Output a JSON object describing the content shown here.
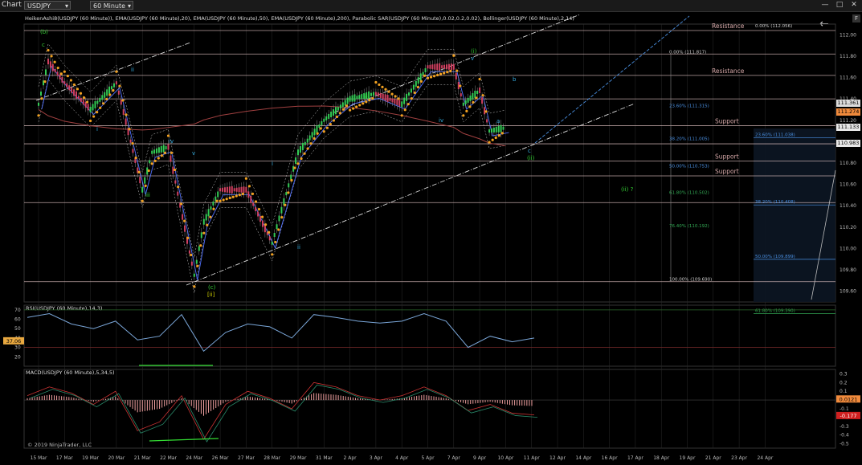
{
  "toolbar": {
    "chart_label": "Chart",
    "instrument": "USDJPY",
    "interval": "60 Minute",
    "back_icon": "arrow-left-icon",
    "f_button": "F"
  },
  "indicators_title": "HeikenAshi8(USDJPY (60 Minute)), EMA(USDJPY (60 Minute),20), EMA(USDJPY (60 Minute),50), EMA(USDJPY (60 Minute),200), Parabolic SAR(USDJPY (60 Minute),0.02,0.2,0.02), Bollinger(USDJPY (60 Minute),2,14)",
  "chart_data": [
    {
      "type": "line",
      "name": "price",
      "x_labels": [
        "15 Mar",
        "17 Mar",
        "19 Mar",
        "20 Mar",
        "21 Mar",
        "22 Mar",
        "24 Mar",
        "26 Mar",
        "27 Mar",
        "28 Mar",
        "29 Mar",
        "31 Mar",
        "2 Apr",
        "3 Apr",
        "4 Apr",
        "5 Apr",
        "7 Apr",
        "9 Apr",
        "10 Apr",
        "11 Apr",
        "12 Apr",
        "14 Apr",
        "16 Apr",
        "17 Apr",
        "18 Apr",
        "19 Apr",
        "21 Apr",
        "23 Apr",
        "24 Apr"
      ],
      "y_ticks": [
        "112.00",
        "111.80",
        "111.60",
        "111.40",
        "111.20",
        "111.00",
        "110.80",
        "110.60",
        "110.40",
        "110.20",
        "110.00",
        "109.80",
        "109.60"
      ],
      "ylim": [
        109.5,
        112.1
      ],
      "current_price": "111.133",
      "price_boxes": [
        {
          "label": "111.361",
          "value": 111.361,
          "bg": "#dcdcdc"
        },
        {
          "label": "111.274",
          "value": 111.274,
          "bg": "#f08a3c"
        },
        {
          "label": "111.133",
          "value": 111.133,
          "bg": "#e8e8e8"
        },
        {
          "label": "110.983",
          "value": 110.983,
          "bg": "#e8e8e8"
        }
      ],
      "levels": [
        {
          "label": "Resistance",
          "value": 112.04
        },
        {
          "label": "",
          "value": 111.82
        },
        {
          "label": "Resistance",
          "value": 111.62
        },
        {
          "label": "",
          "value": 111.4
        },
        {
          "label": "Support",
          "value": 111.15
        },
        {
          "label": "",
          "value": 110.98
        },
        {
          "label": "Support",
          "value": 110.82
        },
        {
          "label": "Support",
          "value": 110.68
        },
        {
          "label": "",
          "value": 110.43
        },
        {
          "label": "",
          "value": 109.69
        }
      ],
      "fib_retracement": [
        {
          "label": "0.00% (111.817)",
          "value": 111.817
        },
        {
          "label": "23.60% (111.315)",
          "value": 111.315
        },
        {
          "label": "38.20% (111.005)",
          "value": 111.005
        },
        {
          "label": "50.00% (110.753)",
          "value": 110.753
        },
        {
          "label": "61.80% (110.502)",
          "value": 110.502
        },
        {
          "label": "76.40% (110.192)",
          "value": 110.192
        },
        {
          "label": "100.00% (109.690)",
          "value": 109.69
        }
      ],
      "fib_extension": [
        {
          "label": "0.00% (112.056)",
          "value": 112.056
        },
        {
          "label": "23.60% (111.038)",
          "value": 111.038
        },
        {
          "label": "38.20% (110.408)",
          "value": 110.408
        },
        {
          "label": "50.00% (109.899)",
          "value": 109.899
        },
        {
          "label": "61.80% (109.390)",
          "value": 109.39
        }
      ],
      "wave_labels": [
        {
          "text": "(b)",
          "color": "#33cc33"
        },
        {
          "text": "c",
          "color": "#33cc33"
        },
        {
          "text": "ii",
          "color": "#33aadd"
        },
        {
          "text": "i",
          "color": "#33aadd"
        },
        {
          "text": "iv",
          "color": "#33aadd"
        },
        {
          "text": "iii",
          "color": "#33cc33"
        },
        {
          "text": "v",
          "color": "#33aadd"
        },
        {
          "text": "(c)",
          "color": "#33cc33"
        },
        {
          "text": "[ii]",
          "color": "#cccc00"
        },
        {
          "text": "i",
          "color": "#33aadd"
        },
        {
          "text": "ii",
          "color": "#33aadd"
        },
        {
          "text": "iii",
          "color": "#33cc33"
        },
        {
          "text": "iv",
          "color": "#33aadd"
        },
        {
          "text": "v",
          "color": "#33aadd"
        },
        {
          "text": "(i)",
          "color": "#33cc33"
        },
        {
          "text": "b",
          "color": "#33aadd"
        },
        {
          "text": "a",
          "color": "#33aadd"
        },
        {
          "text": "c",
          "color": "#33aadd"
        },
        {
          "text": "(ii)",
          "color": "#33cc33"
        },
        {
          "text": "(ii) ?",
          "color": "#33cc33"
        }
      ],
      "approx_close_path": [
        {
          "x": "15 Mar",
          "y": 111.35
        },
        {
          "x": "15 Mar",
          "y": 111.75
        },
        {
          "x": "17 Mar",
          "y": 111.55
        },
        {
          "x": "19 Mar",
          "y": 111.3
        },
        {
          "x": "20 Mar",
          "y": 111.55
        },
        {
          "x": "21 Mar",
          "y": 110.55
        },
        {
          "x": "21 Mar",
          "y": 110.9
        },
        {
          "x": "22 Mar",
          "y": 110.95
        },
        {
          "x": "24 Mar",
          "y": 109.75
        },
        {
          "x": "24 Mar",
          "y": 110.25
        },
        {
          "x": "26 Mar",
          "y": 110.55
        },
        {
          "x": "27 Mar",
          "y": 110.55
        },
        {
          "x": "28 Mar",
          "y": 110.05
        },
        {
          "x": "29 Mar",
          "y": 110.9
        },
        {
          "x": "31 Mar",
          "y": 111.2
        },
        {
          "x": "2 Apr",
          "y": 111.4
        },
        {
          "x": "3 Apr",
          "y": 111.45
        },
        {
          "x": "4 Apr",
          "y": 111.35
        },
        {
          "x": "5 Apr",
          "y": 111.7
        },
        {
          "x": "7 Apr",
          "y": 111.7
        },
        {
          "x": "7 Apr",
          "y": 111.35
        },
        {
          "x": "9 Apr",
          "y": 111.48
        },
        {
          "x": "9 Apr",
          "y": 111.1
        },
        {
          "x": "10 Apr",
          "y": 111.13
        }
      ]
    },
    {
      "type": "line",
      "name": "RSI",
      "title": "RSI(USDJPY (60 Minute),14,3)",
      "y_ticks": [
        "70",
        "60",
        "50",
        "40",
        "30",
        "20"
      ],
      "ylim": [
        10,
        75
      ],
      "current_value": "37.06",
      "levels": [
        70,
        30
      ],
      "approx_values": [
        62,
        66,
        55,
        50,
        58,
        38,
        42,
        65,
        26,
        46,
        55,
        52,
        40,
        65,
        62,
        58,
        56,
        58,
        66,
        58,
        30,
        42,
        36,
        40
      ]
    },
    {
      "type": "bar",
      "name": "MACD",
      "title": "MACD(USDJPY (60 Minute),5,34,5)",
      "y_ticks": [
        "0.3",
        "0.2",
        "0.1",
        "0",
        "-0.1",
        "-0.2",
        "-0.3",
        "-0.4",
        "-0.5"
      ],
      "ylim": [
        -0.55,
        0.35
      ],
      "current_values": [
        "0.0121",
        "-0.177"
      ],
      "approx_macd": [
        0.05,
        0.15,
        0.08,
        -0.05,
        0.1,
        -0.35,
        -0.25,
        0.05,
        -0.45,
        -0.05,
        0.1,
        0.02,
        -0.1,
        0.2,
        0.15,
        0.05,
        0.0,
        0.05,
        0.15,
        0.05,
        -0.12,
        -0.05,
        -0.15,
        -0.17
      ]
    }
  ],
  "copyright": "© 2019 NinjaTrader, LLC",
  "colors": {
    "background": "#000000",
    "grid": "#2b2b2b",
    "level_line": "#e8c8c8",
    "sar": "#f0a020",
    "ema20": "#5070ff",
    "ema200": "#a04040",
    "bollinger": "#cccccc",
    "trendline": "#dddddd",
    "projection": "#4a90e2",
    "rsi_line": "#7aa6d8",
    "macd_hist": "#f0a0a0",
    "divergence": "#33dd33"
  }
}
